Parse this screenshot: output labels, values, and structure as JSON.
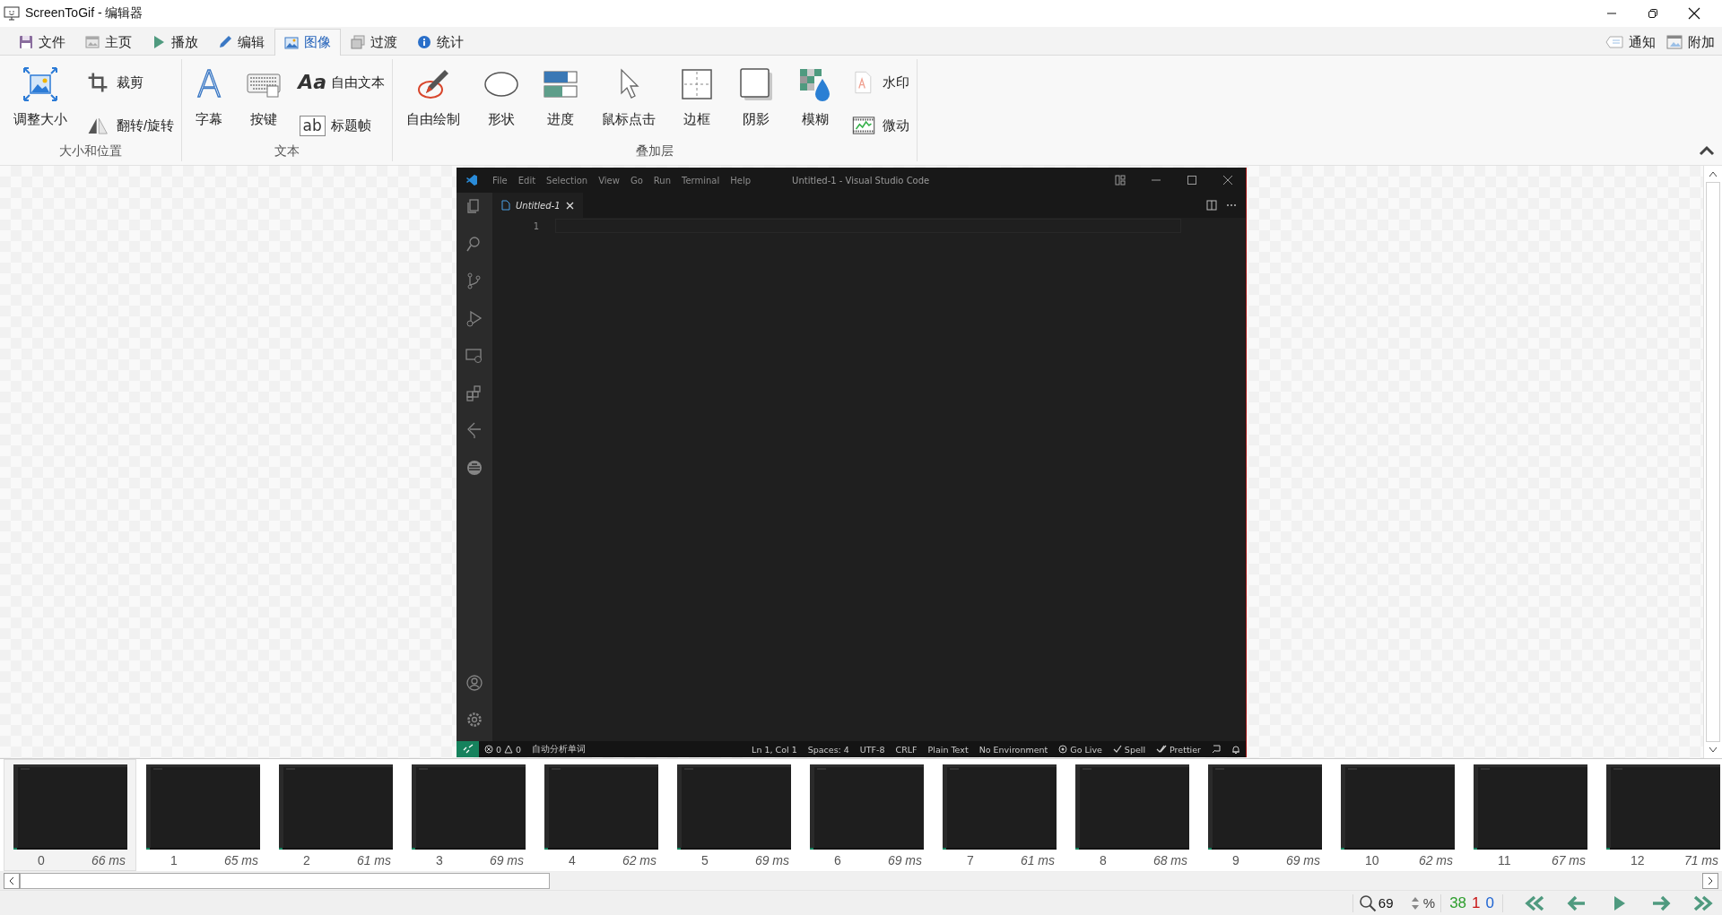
{
  "window": {
    "title": "ScreenToGif - 编辑器"
  },
  "tabs": [
    {
      "label": "文件",
      "selected": false
    },
    {
      "label": "主页",
      "selected": false
    },
    {
      "label": "播放",
      "selected": false
    },
    {
      "label": "编辑",
      "selected": false
    },
    {
      "label": "图像",
      "selected": true
    },
    {
      "label": "过渡",
      "selected": false
    },
    {
      "label": "统计",
      "selected": false
    }
  ],
  "header_buttons": [
    "通知",
    "附加"
  ],
  "ribbon": [
    {
      "label": "大小和位置",
      "buttons": [
        {
          "label": "调整大小",
          "kind": "large"
        },
        {
          "label": "裁剪",
          "kind": "small"
        },
        {
          "label": "翻转/旋转",
          "kind": "small"
        }
      ]
    },
    {
      "label": "文本",
      "buttons": [
        {
          "label": "字幕",
          "kind": "large",
          "glyph": "A"
        },
        {
          "label": "按键",
          "kind": "large"
        },
        {
          "label": "自由文本",
          "kind": "small",
          "glyph": "Aa"
        },
        {
          "label": "标题帧",
          "kind": "small",
          "glyph": "ab"
        }
      ]
    },
    {
      "label": "叠加层",
      "buttons": [
        {
          "label": "自由绘制",
          "kind": "large"
        },
        {
          "label": "形状",
          "kind": "large"
        },
        {
          "label": "进度",
          "kind": "large"
        },
        {
          "label": "鼠标点击",
          "kind": "large"
        },
        {
          "label": "边框",
          "kind": "large"
        },
        {
          "label": "阴影",
          "kind": "large"
        },
        {
          "label": "模糊",
          "kind": "large"
        },
        {
          "label": "水印",
          "kind": "small"
        },
        {
          "label": "微动",
          "kind": "small"
        }
      ]
    }
  ],
  "vscode": {
    "menu": [
      "File",
      "Edit",
      "Selection",
      "View",
      "Go",
      "Run",
      "Terminal",
      "Help"
    ],
    "title": "Untitled-1 - Visual Studio Code",
    "tab": "Untitled-1",
    "line_numbers": [
      "1"
    ],
    "status_left": {
      "errors": "0",
      "warnings": "0",
      "items": [
        "自动分析单词"
      ]
    },
    "status_right": [
      {
        "text": "Ln 1, Col 1",
        "kind": "plain"
      },
      {
        "text": "Spaces: 4",
        "kind": "plain"
      },
      {
        "text": "UTF-8",
        "kind": "plain"
      },
      {
        "text": "CRLF",
        "kind": "plain"
      },
      {
        "text": "Plain Text",
        "kind": "plain"
      },
      {
        "text": "No Environment",
        "kind": "plain"
      },
      {
        "text": "Go Live",
        "kind": "live"
      },
      {
        "text": "Spell",
        "kind": "check"
      },
      {
        "text": "Prettier",
        "kind": "double-check"
      }
    ]
  },
  "frames": [
    {
      "number": "0",
      "duration": "66 ms",
      "selected": true
    },
    {
      "number": "1",
      "duration": "65 ms",
      "selected": false
    },
    {
      "number": "2",
      "duration": "61 ms",
      "selected": false
    },
    {
      "number": "3",
      "duration": "69 ms",
      "selected": false
    },
    {
      "number": "4",
      "duration": "62 ms",
      "selected": false
    },
    {
      "number": "5",
      "duration": "69 ms",
      "selected": false
    },
    {
      "number": "6",
      "duration": "69 ms",
      "selected": false
    },
    {
      "number": "7",
      "duration": "61 ms",
      "selected": false
    },
    {
      "number": "8",
      "duration": "68 ms",
      "selected": false
    },
    {
      "number": "9",
      "duration": "69 ms",
      "selected": false
    },
    {
      "number": "10",
      "duration": "62 ms",
      "selected": false
    },
    {
      "number": "11",
      "duration": "67 ms",
      "selected": false
    },
    {
      "number": "12",
      "duration": "71 ms",
      "selected": false
    }
  ],
  "status_bar": {
    "zoom": "69",
    "unit": "%",
    "counts": [
      {
        "text": "38",
        "color": "#2e9e2e"
      },
      {
        "text": "1",
        "color": "#c81414"
      },
      {
        "text": "0",
        "color": "#1e64d2"
      }
    ]
  }
}
